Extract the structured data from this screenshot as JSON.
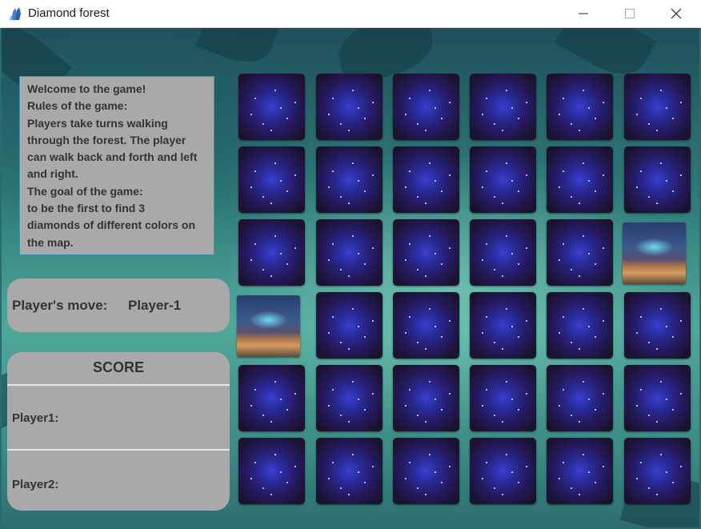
{
  "window": {
    "title": "Diamond forest",
    "app_icon": "crystal-icon",
    "controls": [
      "minimize-icon",
      "maximize-icon",
      "close-icon"
    ]
  },
  "rules": {
    "lines": [
      "Welcome to the game!",
      "Rules of the game:",
      "Players take turns walking",
      "through the forest. The player",
      "can walk back and forth and left",
      "and right.",
      "The goal of the game:",
      "to be the first to find 3",
      "diamonds of different colors on",
      "the map."
    ]
  },
  "move": {
    "label": "Player's move:",
    "value": "Player-1"
  },
  "score": {
    "title": "SCORE",
    "player1_label": "Player1:",
    "player2_label": "Player2:"
  },
  "board": {
    "rows": 6,
    "cols": 6,
    "tiles": [
      [
        "hidden",
        "hidden",
        "hidden",
        "hidden",
        "hidden",
        "hidden"
      ],
      [
        "hidden",
        "hidden",
        "hidden",
        "hidden",
        "hidden",
        "hidden"
      ],
      [
        "hidden",
        "hidden",
        "hidden",
        "hidden",
        "hidden",
        "revealed-empty"
      ],
      [
        "revealed-empty",
        "hidden",
        "hidden",
        "hidden",
        "hidden",
        "hidden"
      ],
      [
        "hidden",
        "hidden",
        "hidden",
        "hidden",
        "hidden",
        "hidden"
      ],
      [
        "hidden",
        "hidden",
        "hidden",
        "hidden",
        "hidden",
        "hidden"
      ]
    ]
  },
  "colors": {
    "panel": "#a9a9a9",
    "panel_text": "#333333",
    "rules_border": "#3f8fb0"
  }
}
